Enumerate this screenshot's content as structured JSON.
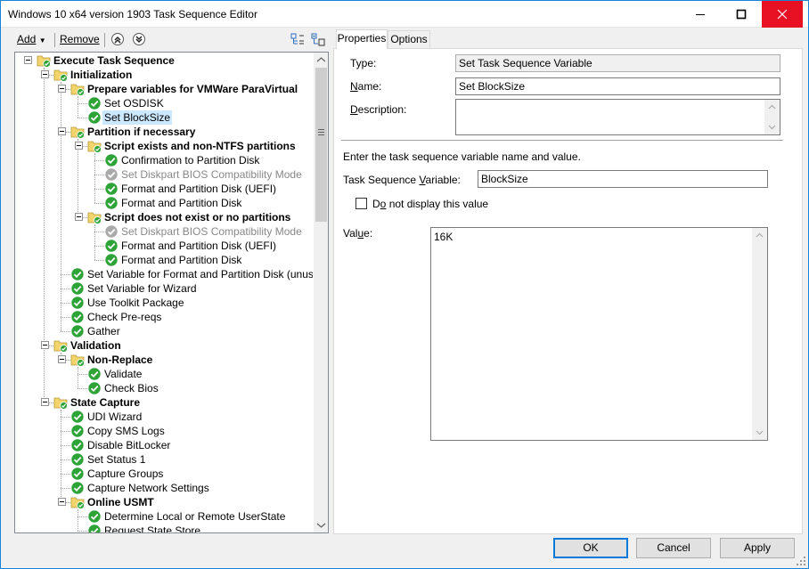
{
  "window": {
    "title": "Windows 10 x64 version 1903 Task Sequence Editor"
  },
  "toolbar": {
    "add_label": "Add",
    "remove_label": "Remove"
  },
  "tree": {
    "nodes": [
      {
        "label": "Execute Task Sequence",
        "level": 0,
        "kind": "group"
      },
      {
        "label": "Initialization",
        "level": 1,
        "kind": "group"
      },
      {
        "label": "Prepare variables for VMWare ParaVirtual",
        "level": 2,
        "kind": "group"
      },
      {
        "label": "Set OSDISK",
        "level": 3,
        "kind": "step"
      },
      {
        "label": "Set BlockSize",
        "level": 3,
        "kind": "step",
        "selected": true
      },
      {
        "label": "Partition if necessary",
        "level": 2,
        "kind": "group"
      },
      {
        "label": "Script exists and non-NTFS partitions",
        "level": 3,
        "kind": "group"
      },
      {
        "label": "Confirmation to Partition Disk",
        "level": 4,
        "kind": "step"
      },
      {
        "label": "Set Diskpart BIOS Compatibility Mode",
        "level": 4,
        "kind": "step",
        "disabled": true
      },
      {
        "label": "Format and Partition Disk (UEFI)",
        "level": 4,
        "kind": "step"
      },
      {
        "label": "Format and Partition Disk",
        "level": 4,
        "kind": "step"
      },
      {
        "label": "Script does not exist or no partitions",
        "level": 3,
        "kind": "group"
      },
      {
        "label": "Set Diskpart BIOS Compatibility Mode",
        "level": 4,
        "kind": "step",
        "disabled": true
      },
      {
        "label": "Format and Partition Disk (UEFI)",
        "level": 4,
        "kind": "step"
      },
      {
        "label": "Format and Partition Disk",
        "level": 4,
        "kind": "step"
      },
      {
        "label": "Set Variable for Format and Partition Disk (unused)",
        "level": 2,
        "kind": "step"
      },
      {
        "label": "Set Variable for Wizard",
        "level": 2,
        "kind": "step"
      },
      {
        "label": "Use Toolkit Package",
        "level": 2,
        "kind": "step"
      },
      {
        "label": "Check Pre-reqs",
        "level": 2,
        "kind": "step"
      },
      {
        "label": "Gather",
        "level": 2,
        "kind": "step"
      },
      {
        "label": "Validation",
        "level": 1,
        "kind": "group"
      },
      {
        "label": "Non-Replace",
        "level": 2,
        "kind": "group"
      },
      {
        "label": "Validate",
        "level": 3,
        "kind": "step"
      },
      {
        "label": "Check Bios",
        "level": 3,
        "kind": "step"
      },
      {
        "label": "State Capture",
        "level": 1,
        "kind": "group"
      },
      {
        "label": "UDI Wizard",
        "level": 2,
        "kind": "step"
      },
      {
        "label": "Copy SMS Logs",
        "level": 2,
        "kind": "step"
      },
      {
        "label": "Disable BitLocker",
        "level": 2,
        "kind": "step"
      },
      {
        "label": "Set Status 1",
        "level": 2,
        "kind": "step"
      },
      {
        "label": "Capture Groups",
        "level": 2,
        "kind": "step"
      },
      {
        "label": "Capture Network Settings",
        "level": 2,
        "kind": "step"
      },
      {
        "label": "Online USMT",
        "level": 2,
        "kind": "group"
      },
      {
        "label": "Determine Local or Remote UserState",
        "level": 3,
        "kind": "step"
      },
      {
        "label": "Request State Store",
        "level": 3,
        "kind": "step"
      }
    ]
  },
  "tabs": {
    "properties": "Properties",
    "options": "Options"
  },
  "properties": {
    "type_label": "Type:",
    "type_value": "Set Task Sequence Variable",
    "name_label": "Name:",
    "name_value": "Set BlockSize",
    "description_label": "Description:",
    "description_value": "",
    "instruction": "Enter the task sequence variable name and value.",
    "tsv_label": "Task Sequence Variable:",
    "tsv_value": "BlockSize",
    "hide_value_label": "Do not display this value",
    "value_label": "Value:",
    "value_value": "16K"
  },
  "buttons": {
    "ok": "OK",
    "cancel": "Cancel",
    "apply": "Apply"
  },
  "colors": {
    "accent": "#0078d7",
    "check_green": "#2ea338",
    "folder_yellow": "#f3d36b"
  }
}
